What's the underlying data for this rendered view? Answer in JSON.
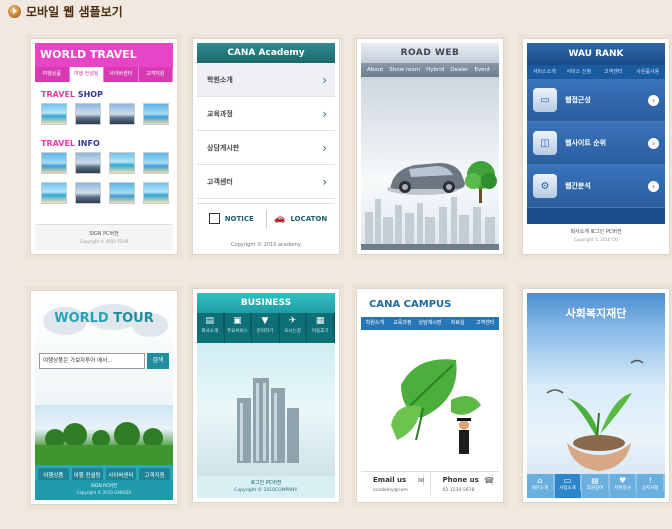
{
  "header": {
    "title": "모바일 웹 샘플보기"
  },
  "cards": {
    "world_travel": {
      "title": "WORLD TRAVEL",
      "tabs": [
        "여행상품",
        "여행 컨설팅",
        "사이버센터",
        "고객지원"
      ],
      "section1_accent": "TRAVEL",
      "section1_rest": " SHOP",
      "section2_accent": "TRAVEL",
      "section2_rest": " INFO",
      "footer_links": "SIGN    PC버전",
      "copyright": "Copyright © 2010 TOUR"
    },
    "cana_academy": {
      "title": "CANA Academy",
      "items": [
        "학원소개",
        "교육과정",
        "상담게시판",
        "고객센터"
      ],
      "notice": "NOTICE",
      "location": "LOCATON",
      "copyright": "Copyright © 2010 academy"
    },
    "road_web": {
      "title": "ROAD WEB",
      "nav": [
        "About",
        "Show room",
        "Hybrid",
        "Dealer",
        "Event"
      ]
    },
    "wau_rank": {
      "title": "WAU RANK",
      "tabs": [
        "서비스소개",
        "서비스 신청",
        "고객센터",
        "사은품사용"
      ],
      "items": [
        "웹접근성",
        "웹사이트 순위",
        "웹간분석"
      ],
      "footer_links": "회사소개    로그인    PC버전",
      "copyright": "Copyright © 2010 OO"
    },
    "world_tour": {
      "title_accent": "WORLD",
      "title_rest": " TOUR",
      "search_value": "여행상품은 가보자투어 에서...",
      "search_button": "검색",
      "menu": [
        "여행상품",
        "여행 컨설팅",
        "사이버센터",
        "고객지원"
      ],
      "footer_links": "SIGN    PC버전",
      "copyright": "Copyright © 2010 GABOZA"
    },
    "business": {
      "title": "BUSINESS",
      "menu": [
        "회사소개",
        "주요서비스",
        "문의하기",
        "오시는길",
        "이용후기"
      ],
      "footer_links": "로그인    PC버전",
      "copyright": "Copyright © 2010COMPANY."
    },
    "cana_campus": {
      "title": "CANA CAMPUS",
      "tabs": [
        "학원소개",
        "교육과정",
        "상담게시판",
        "자료실",
        "고객센터"
      ],
      "email_label": "Email us",
      "email_value": "academy@com",
      "phone_label": "Phone us",
      "phone_value": "02-1234-5678"
    },
    "social_welfare": {
      "title": "사회복지재단",
      "menu": [
        "재단소개",
        "사업소개",
        "후원참여",
        "자원봉사",
        "공지사항"
      ]
    }
  }
}
